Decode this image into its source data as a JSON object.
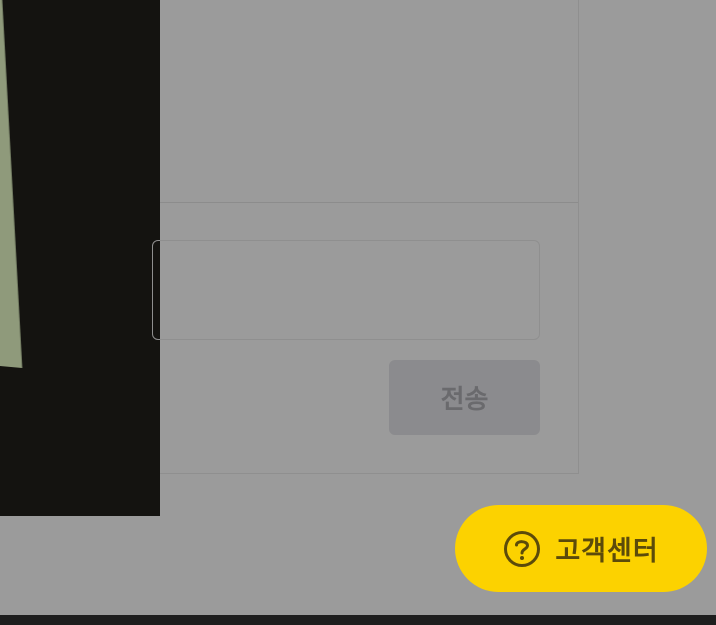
{
  "composer": {
    "send_label": "전송"
  },
  "help": {
    "label": "고객센터",
    "icon": "question-circle-icon"
  },
  "colors": {
    "overlay": "#9b9b9b",
    "help_button": "#fcd200",
    "help_text": "#5c4b0a",
    "send_button": "#8b8b8e"
  }
}
